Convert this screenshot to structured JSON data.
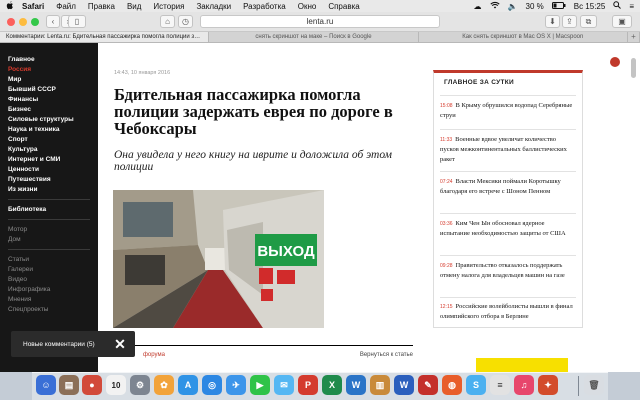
{
  "menubar": {
    "apple": "",
    "app_name": "Safari",
    "items": [
      "Файл",
      "Правка",
      "Вид",
      "История",
      "Закладки",
      "Разработка",
      "Окно",
      "Справка"
    ],
    "battery": "30 %",
    "clock": "Вс 15:25"
  },
  "toolbar": {
    "url": "lenta.ru"
  },
  "tabs": [
    {
      "label": "Комментарии: Lenta.ru: Бдительная пассажирка помогла полиции задер...",
      "active": true
    },
    {
      "label": "снять скриншот на маке – Поиск в Google",
      "active": false
    },
    {
      "label": "Как снять скриншот в Mac OS X | Macspoon",
      "active": false
    }
  ],
  "nav": {
    "primary": [
      "Главное",
      "Россия",
      "Мир",
      "Бывший СССР",
      "Финансы",
      "Бизнес",
      "Силовые структуры",
      "Наука и техника",
      "Спорт",
      "Культура",
      "Интернет и СМИ",
      "Ценности",
      "Путешествия",
      "Из жизни"
    ],
    "library": "Библиотека",
    "secondary": [
      "Мотор",
      "Дом"
    ],
    "tertiary": [
      "Статьи",
      "Галереи",
      "Видео",
      "Инфографика",
      "Мнения",
      "Спецпроекты"
    ]
  },
  "article": {
    "date": "14:43, 10 января 2016",
    "headline": "Бдительная пассажирка помогла полиции задержать еврея по дороге в Чебоксары",
    "subtitle": "Она увидела у него книгу на иврите и доложила об этом полиции",
    "photo_sign": "ВЫХОД",
    "forum_link": "форума",
    "back_link": "Вернуться к статье"
  },
  "sidebar": {
    "title": "ГЛАВНОЕ ЗА СУТКИ",
    "items": [
      {
        "time": "15:08",
        "text": "В Крыму обрушился водопад Серебряные струи"
      },
      {
        "time": "11:33",
        "text": "Военные вдвое увеличат количество пусков межконтинентальных баллистических ракет"
      },
      {
        "time": "07:24",
        "text": "Власти Мексики поймали Коротышку благодаря его встрече с Шоном Пенном"
      },
      {
        "time": "03:36",
        "text": "Ким Чен Ын обосновал ядерное испытание необходимостью защиты от США"
      },
      {
        "time": "09:28",
        "text": "Правительство отказалось поддержать отмену налога для владельцев машин на газе"
      },
      {
        "time": "12:15",
        "text": "Российские волейболисты вышли в финал олимпийского отбора в Берлине"
      }
    ]
  },
  "notification": {
    "text": "Новые комментарии (5)",
    "close": "✕"
  },
  "dock": {
    "calendar_day": "10",
    "badge": "3"
  },
  "colors": {
    "accent": "#d53a2c",
    "nav_bg": "#171717",
    "highlight": "#f7e000"
  }
}
